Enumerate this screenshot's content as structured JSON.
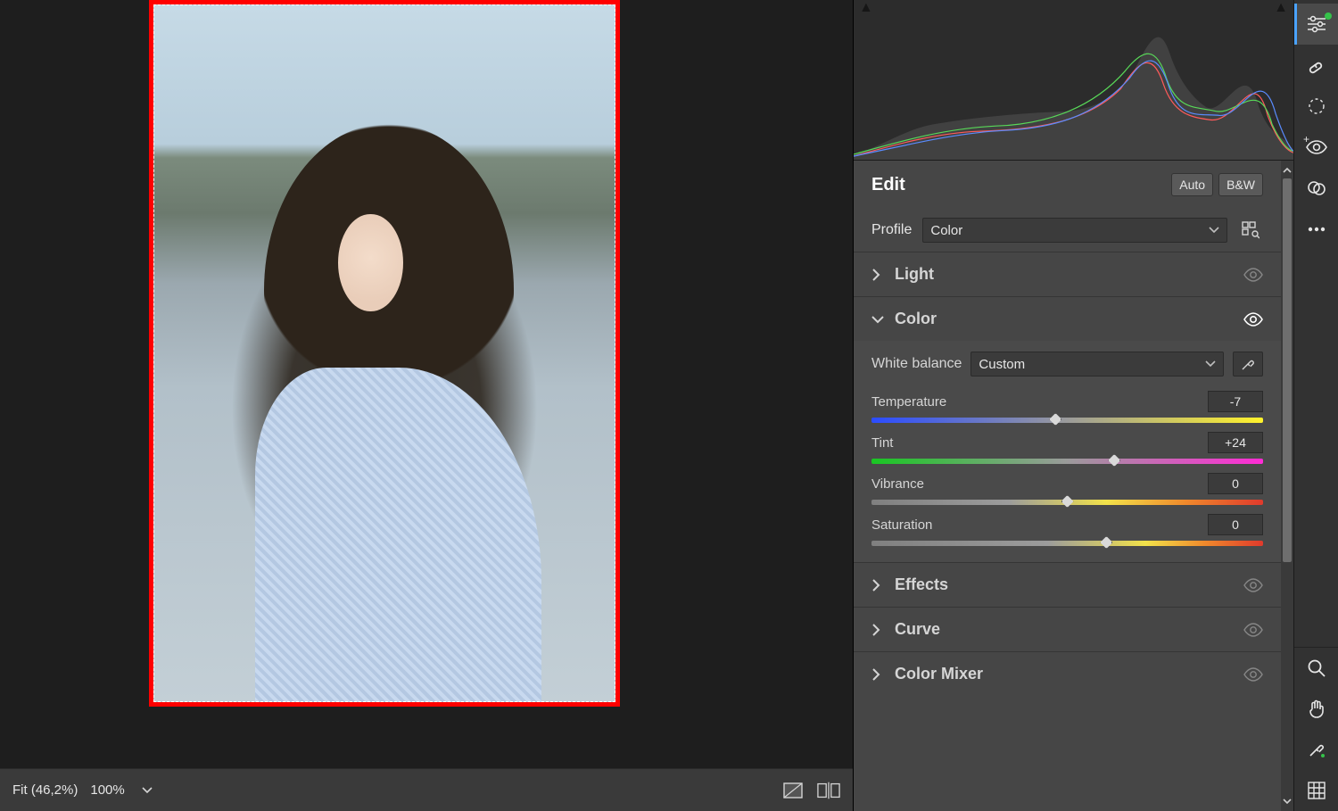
{
  "status": {
    "fit": "Fit (46,2%)",
    "zoom": "100%"
  },
  "edit": {
    "title": "Edit",
    "auto_btn": "Auto",
    "bw_btn": "B&W",
    "profile_label": "Profile",
    "profile_value": "Color"
  },
  "sections": {
    "light": {
      "title": "Light"
    },
    "color": {
      "title": "Color",
      "wb_label": "White balance",
      "wb_value": "Custom",
      "sliders": {
        "temperature": {
          "label": "Temperature",
          "value": "-7",
          "pos": 47
        },
        "tint": {
          "label": "Tint",
          "value": "+24",
          "pos": 62
        },
        "vibrance": {
          "label": "Vibrance",
          "value": "0",
          "pos": 50
        },
        "saturation": {
          "label": "Saturation",
          "value": "0",
          "pos": 60
        }
      }
    },
    "effects": {
      "title": "Effects"
    },
    "curve": {
      "title": "Curve"
    },
    "color_mixer": {
      "title": "Color Mixer"
    }
  }
}
